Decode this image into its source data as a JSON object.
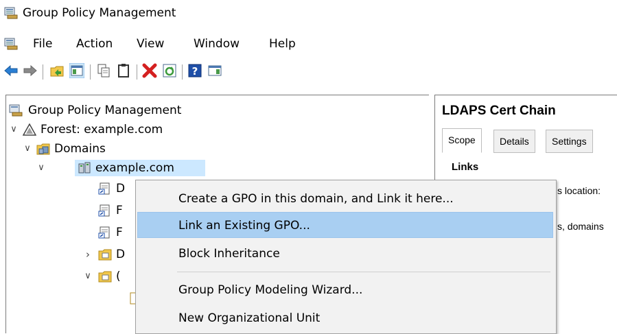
{
  "window": {
    "title": "Group Policy Management"
  },
  "menu": {
    "items": [
      "File",
      "Action",
      "View",
      "Window",
      "Help"
    ]
  },
  "toolbar": {
    "buttons": [
      "back-icon",
      "forward-icon",
      "up-folder-icon",
      "show-hide-console-tree-icon",
      "copy-icon",
      "paste-icon",
      "delete-icon",
      "refresh-icon",
      "help-icon",
      "show-action-pane-icon"
    ]
  },
  "tree": {
    "root": "Group Policy Management",
    "forest": "Forest: example.com",
    "domains": "Domains",
    "domain": "example.com",
    "children_partial": [
      "D",
      "F",
      "F",
      "D",
      "("
    ]
  },
  "right_pane": {
    "title": "LDAPS Cert Chain",
    "tabs": [
      "Scope",
      "Details",
      "Settings"
    ],
    "links_heading": "Links",
    "line1": "s location:",
    "line2": "s, domains"
  },
  "context_menu": {
    "items": [
      "Create a GPO in this domain, and Link it here...",
      "Link an Existing GPO...",
      "Block Inheritance",
      "Group Policy Modeling Wizard...",
      "New Organizational Unit"
    ],
    "highlighted_index": 1
  },
  "colors": {
    "highlight": "#a9cff2",
    "selection": "#cce8ff"
  }
}
